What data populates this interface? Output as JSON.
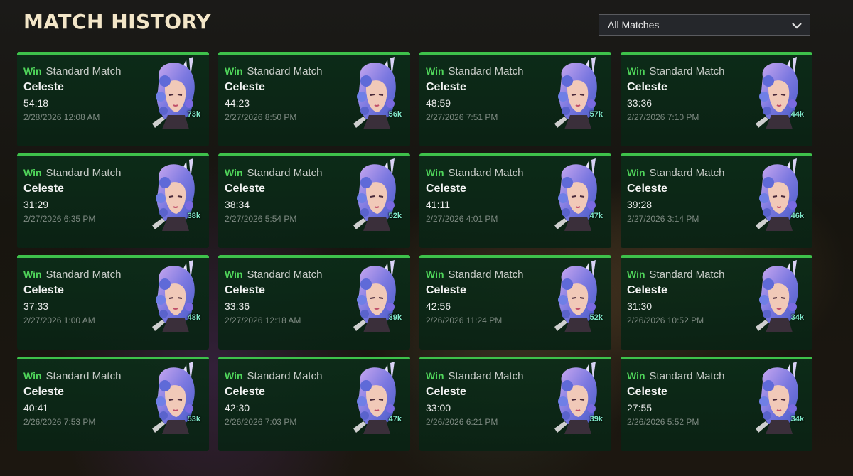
{
  "page": {
    "title": "MATCH HISTORY"
  },
  "filter": {
    "selected": "All Matches",
    "icon": "chevron-down-icon"
  },
  "colors": {
    "win": "#4fd45a",
    "card_top": "#3ec14b",
    "title": "#f3e6c8"
  },
  "matches": [
    {
      "result": "Win",
      "mode": "Standard Match",
      "champion": "Celeste",
      "duration": "54:18",
      "date": "2/28/2026 12:08 AM",
      "damage": "73k"
    },
    {
      "result": "Win",
      "mode": "Standard Match",
      "champion": "Celeste",
      "duration": "44:23",
      "date": "2/27/2026 8:50 PM",
      "damage": "56k"
    },
    {
      "result": "Win",
      "mode": "Standard Match",
      "champion": "Celeste",
      "duration": "48:59",
      "date": "2/27/2026 7:51 PM",
      "damage": "57k"
    },
    {
      "result": "Win",
      "mode": "Standard Match",
      "champion": "Celeste",
      "duration": "33:36",
      "date": "2/27/2026 7:10 PM",
      "damage": "44k"
    },
    {
      "result": "Win",
      "mode": "Standard Match",
      "champion": "Celeste",
      "duration": "31:29",
      "date": "2/27/2026 6:35 PM",
      "damage": "38k"
    },
    {
      "result": "Win",
      "mode": "Standard Match",
      "champion": "Celeste",
      "duration": "38:34",
      "date": "2/27/2026 5:54 PM",
      "damage": "52k"
    },
    {
      "result": "Win",
      "mode": "Standard Match",
      "champion": "Celeste",
      "duration": "41:11",
      "date": "2/27/2026 4:01 PM",
      "damage": "47k"
    },
    {
      "result": "Win",
      "mode": "Standard Match",
      "champion": "Celeste",
      "duration": "39:28",
      "date": "2/27/2026 3:14 PM",
      "damage": "46k"
    },
    {
      "result": "Win",
      "mode": "Standard Match",
      "champion": "Celeste",
      "duration": "37:33",
      "date": "2/27/2026 1:00 AM",
      "damage": "48k"
    },
    {
      "result": "Win",
      "mode": "Standard Match",
      "champion": "Celeste",
      "duration": "33:36",
      "date": "2/27/2026 12:18 AM",
      "damage": "39k"
    },
    {
      "result": "Win",
      "mode": "Standard Match",
      "champion": "Celeste",
      "duration": "42:56",
      "date": "2/26/2026 11:24 PM",
      "damage": "52k"
    },
    {
      "result": "Win",
      "mode": "Standard Match",
      "champion": "Celeste",
      "duration": "31:30",
      "date": "2/26/2026 10:52 PM",
      "damage": "34k"
    },
    {
      "result": "Win",
      "mode": "Standard Match",
      "champion": "Celeste",
      "duration": "40:41",
      "date": "2/26/2026 7:53 PM",
      "damage": "53k"
    },
    {
      "result": "Win",
      "mode": "Standard Match",
      "champion": "Celeste",
      "duration": "42:30",
      "date": "2/26/2026 7:03 PM",
      "damage": "47k"
    },
    {
      "result": "Win",
      "mode": "Standard Match",
      "champion": "Celeste",
      "duration": "33:00",
      "date": "2/26/2026 6:21 PM",
      "damage": "39k"
    },
    {
      "result": "Win",
      "mode": "Standard Match",
      "champion": "Celeste",
      "duration": "27:55",
      "date": "2/26/2026 5:52 PM",
      "damage": "34k"
    }
  ]
}
